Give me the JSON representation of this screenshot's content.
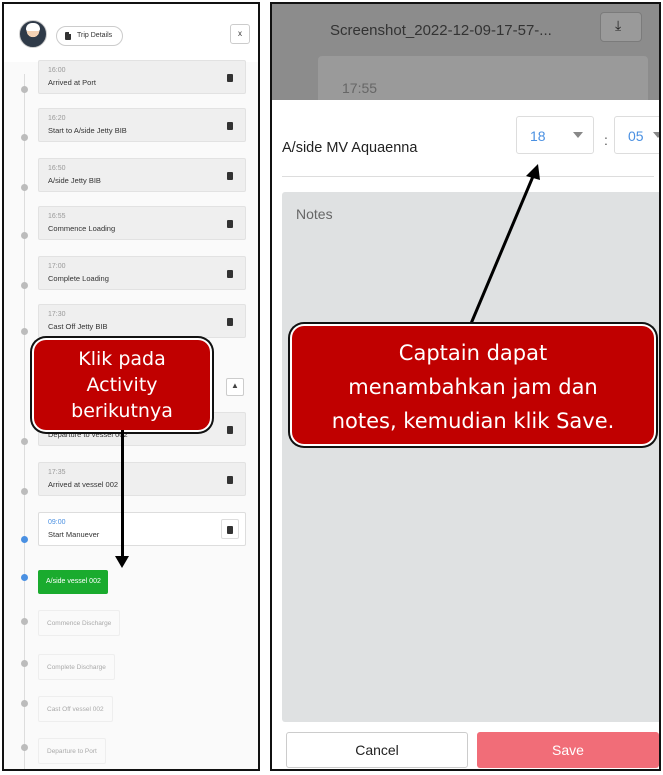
{
  "left_panel": {
    "header": {
      "trip_details_label": "Trip Details",
      "close_label": "x"
    },
    "activities": [
      {
        "time": "16:00",
        "name": "Arrived at Port"
      },
      {
        "time": "16:20",
        "name": "Start to A/side Jetty BIB"
      },
      {
        "time": "16:50",
        "name": "A/side Jetty BIB"
      },
      {
        "time": "16:55",
        "name": "Commence Loading"
      },
      {
        "time": "17:00",
        "name": "Complete Loading"
      },
      {
        "time": "17:30",
        "name": "Cast Off Jetty BIB"
      },
      {
        "time": "",
        "name": "Departure to vessel 002"
      },
      {
        "time": "17:35",
        "name": "Arrived at vessel 002"
      },
      {
        "time": "09:00",
        "name": "Start Manuever"
      }
    ],
    "next_activity": "A/side vessel 002",
    "pending": [
      "Commence Discharge",
      "Complete Discharge",
      "Cast Off vessel 002",
      "Departure to Port"
    ],
    "callout": {
      "line1": "Klik pada",
      "line2": "Activity",
      "line3": "berikutnya"
    }
  },
  "right_panel": {
    "background": {
      "title": "Screenshot_2022-12-09-17-57-...",
      "card_time": "17:55"
    },
    "activity_name": "A/side MV Aquaenna",
    "hour": "18",
    "colon": ":",
    "minute": "05",
    "notes_placeholder": "Notes",
    "cancel_label": "Cancel",
    "save_label": "Save",
    "callout": {
      "line1": "Captain dapat",
      "line2": "menambahkan jam dan",
      "line3": "notes, kemudian klik Save."
    }
  },
  "colors": {
    "accent_blue": "#4a90e2",
    "green": "#1aab2e",
    "save_pink": "#f16d78",
    "callout_red": "#c00000"
  }
}
